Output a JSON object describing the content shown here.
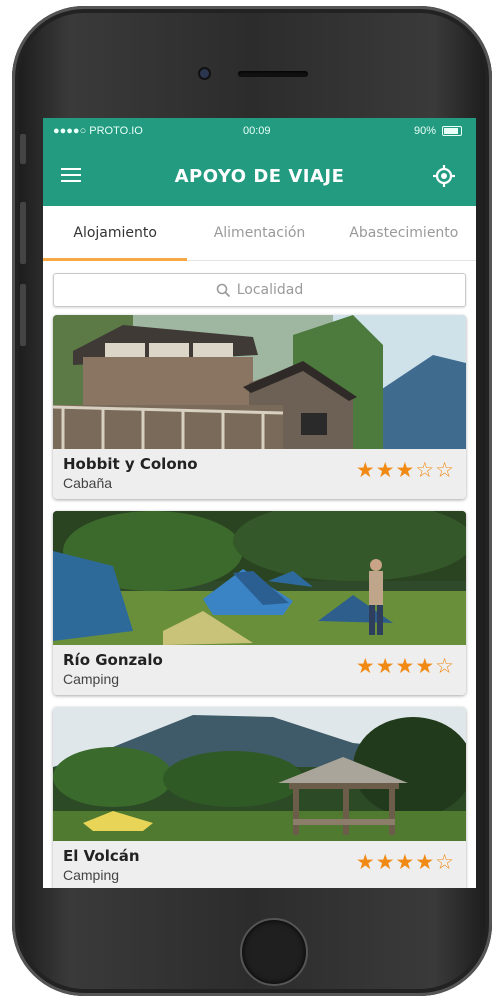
{
  "status_bar": {
    "carrier": "●●●●○ PROTO.IO",
    "time": "00:09",
    "battery": "90%"
  },
  "app_bar": {
    "title": "APOYO DE VIAJE",
    "menu_icon": "hamburger-menu-icon",
    "locate_icon": "target-location-icon"
  },
  "tabs": [
    {
      "label": "Alojamiento",
      "active": true
    },
    {
      "label": "Alimentación",
      "active": false
    },
    {
      "label": "Abastecimiento",
      "active": false
    }
  ],
  "search": {
    "placeholder": "Localidad",
    "icon": "search-icon"
  },
  "listings": [
    {
      "name": "Hobbit y Colono",
      "type": "Cabaña",
      "rating": 3,
      "max_rating": 5
    },
    {
      "name": "Río Gonzalo",
      "type": "Camping",
      "rating": 4,
      "max_rating": 5
    },
    {
      "name": "El Volcán",
      "type": "Camping",
      "rating": 4,
      "max_rating": 5
    }
  ],
  "colors": {
    "brand": "#229b80",
    "tab_indicator": "#f7a845",
    "star": "#f18a15"
  }
}
